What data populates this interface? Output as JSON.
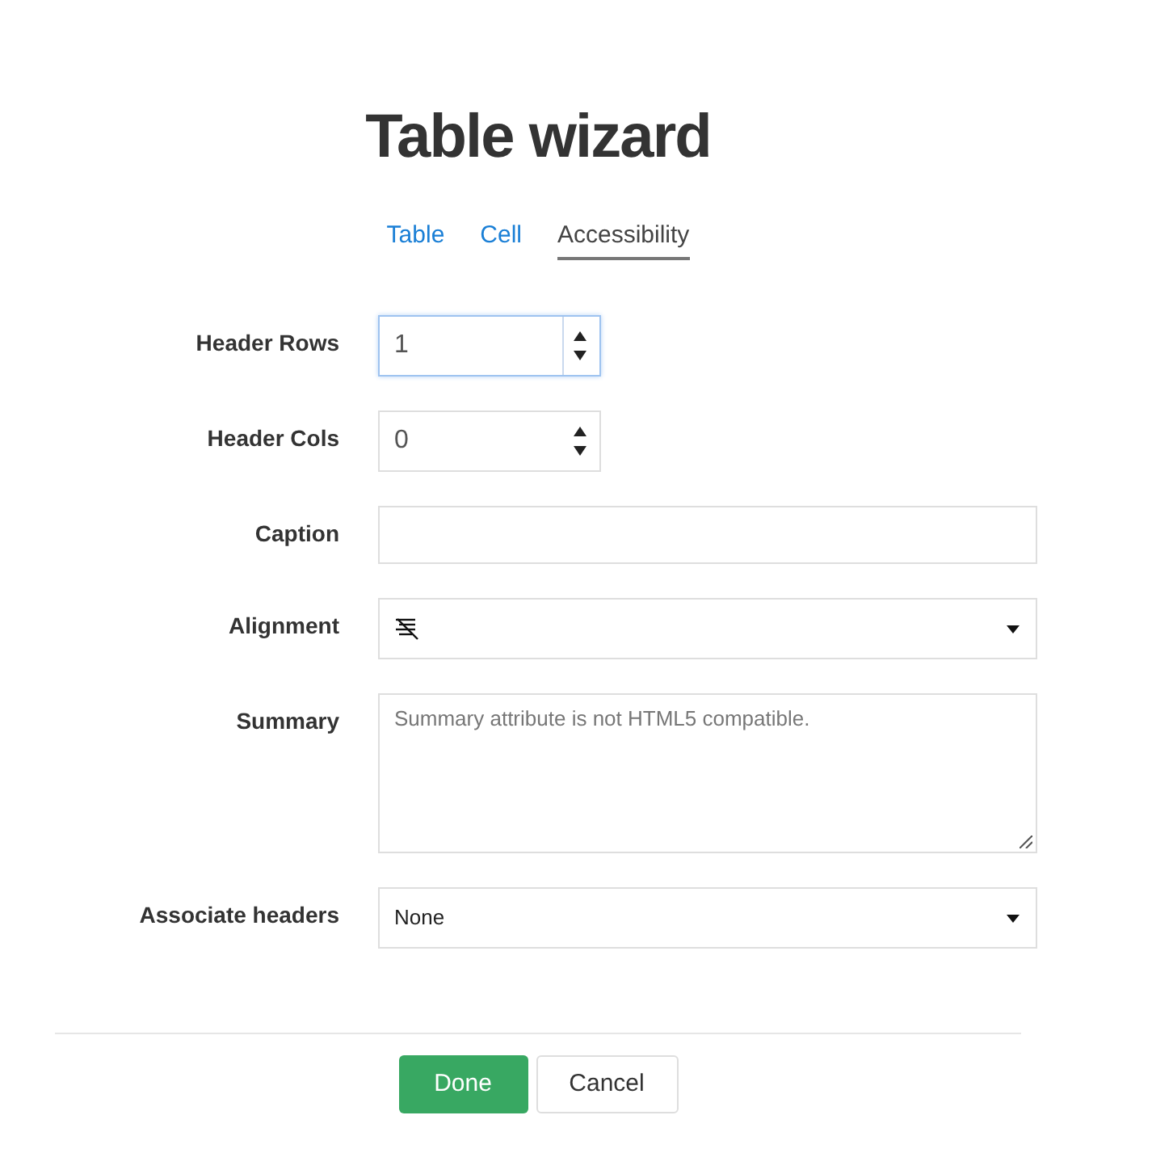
{
  "dialog": {
    "title": "Table wizard"
  },
  "tabs": [
    {
      "label": "Table",
      "selected": false
    },
    {
      "label": "Cell",
      "selected": false
    },
    {
      "label": "Accessibility",
      "selected": true
    }
  ],
  "fields": [
    {
      "kind": "number",
      "label": "Header Rows",
      "value": "1",
      "focused": true
    },
    {
      "kind": "number",
      "label": "Header Cols",
      "value": "0",
      "focused": false
    },
    {
      "kind": "text",
      "label": "Caption"
    },
    {
      "kind": "icon_select",
      "label": "Alignment"
    },
    {
      "kind": "textarea",
      "label": "Summary",
      "placeholder": "Summary attribute is not HTML5 compatible."
    },
    {
      "kind": "select",
      "label": "Associate headers",
      "value": "None"
    }
  ],
  "buttons": [
    {
      "label": "Done",
      "kind": "primary"
    },
    {
      "label": "Cancel",
      "kind": "secondary"
    }
  ]
}
